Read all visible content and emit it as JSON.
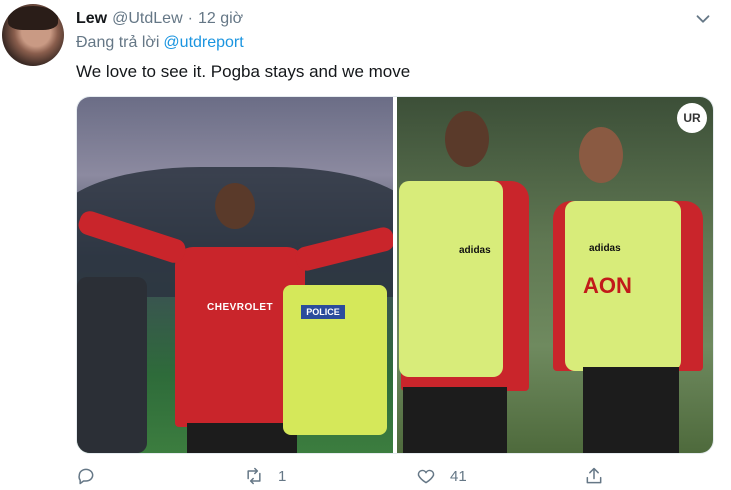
{
  "tweet": {
    "display_name": "Lew",
    "handle": "@UtdLew",
    "separator": "·",
    "time": "12 giờ",
    "reply_prefix": "Đang trả lời",
    "reply_to": "@utdreport",
    "text": "We love to see it. Pogba stays and we move"
  },
  "media": {
    "left_photo": {
      "sponsor_text": "CHEVROLET",
      "police_text": "POLICE"
    },
    "right_photo": {
      "logo_text": "UR",
      "sponsor_text": "AON",
      "kit_brand": "adidas"
    }
  },
  "actions": {
    "reply_icon": "reply-icon",
    "retweet_icon": "retweet-icon",
    "retweet_count": "1",
    "like_icon": "heart-icon",
    "like_count": "41",
    "share_icon": "share-icon"
  },
  "colors": {
    "link": "#1b95e0",
    "secondary_text": "#657786",
    "primary_text": "#14171a"
  }
}
